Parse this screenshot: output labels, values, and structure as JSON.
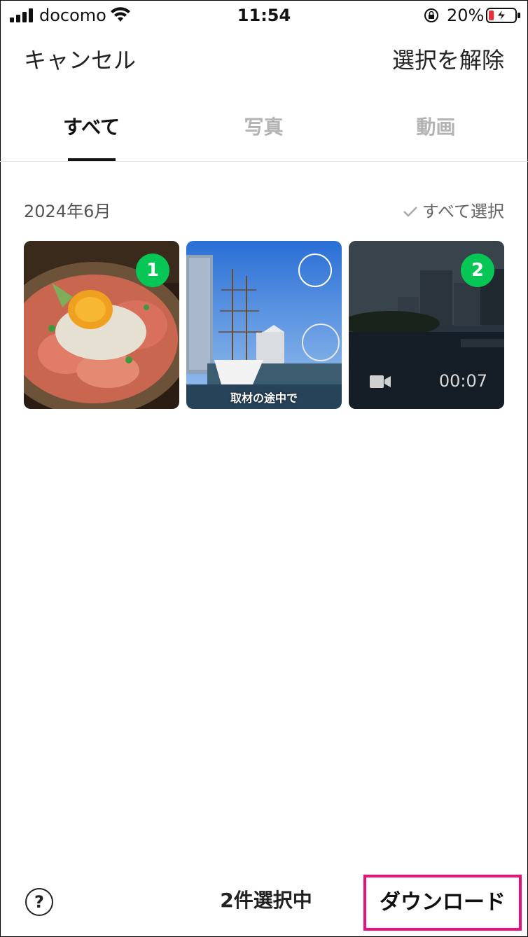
{
  "status_bar": {
    "carrier": "docomo",
    "time": "11:54",
    "battery_percent": "20%",
    "battery_level": 0.2,
    "icons": [
      "signal-icon",
      "wifi-icon",
      "orientation-lock-icon",
      "battery-charging-icon"
    ]
  },
  "header": {
    "cancel_label": "キャンセル",
    "deselect_label": "選択を解除"
  },
  "tabs": [
    {
      "label": "すべて",
      "active": true
    },
    {
      "label": "写真",
      "active": false
    },
    {
      "label": "動画",
      "active": false
    }
  ],
  "section": {
    "month_label": "2024年6月",
    "select_all_label": "すべて選択"
  },
  "media": [
    {
      "type": "photo",
      "selected": true,
      "selection_number": "1"
    },
    {
      "type": "photo",
      "selected": false,
      "caption": "取材の途中で"
    },
    {
      "type": "video",
      "selected": true,
      "selection_number": "2",
      "duration": "00:07"
    }
  ],
  "footer": {
    "help_label": "?",
    "selected_count_label": "2件選択中",
    "download_label": "ダウンロード"
  },
  "colors": {
    "accent_green": "#06c755",
    "highlight_pink": "#e8107a",
    "inactive_tab": "#b3b3b3"
  }
}
